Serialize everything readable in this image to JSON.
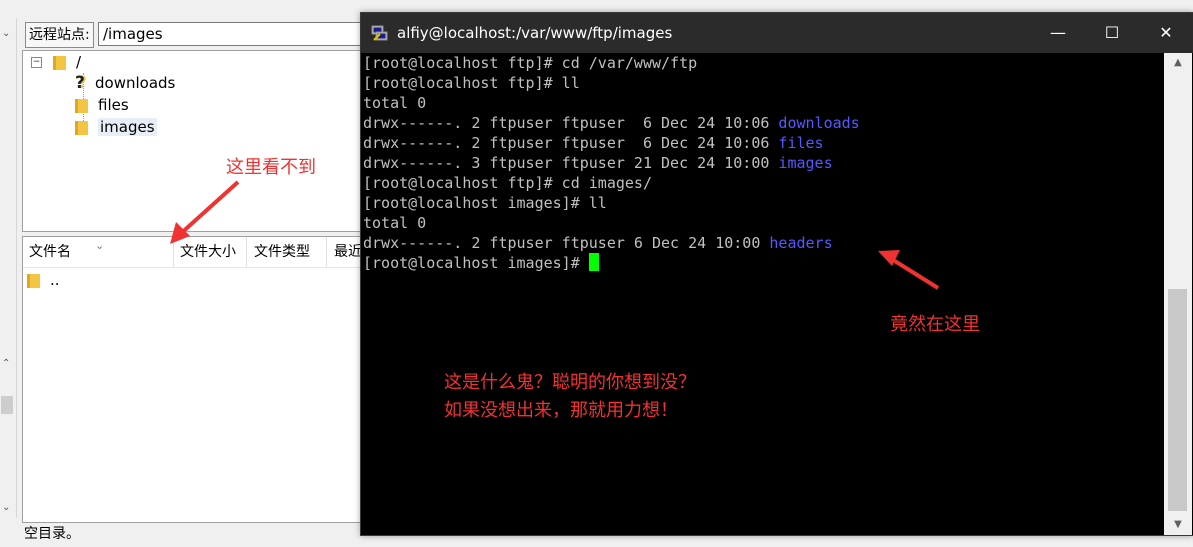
{
  "filezilla": {
    "remote_site_label": "远程站点:",
    "remote_site_path": "/images",
    "tree": {
      "root": "/",
      "children": [
        "downloads",
        "files",
        "images"
      ],
      "selected": "images"
    },
    "list_columns": [
      "文件名",
      "文件大小",
      "文件类型",
      "最近"
    ],
    "list_rows": [
      ".."
    ],
    "status": "空目录。"
  },
  "terminal": {
    "title": "alfiy@localhost:/var/www/ftp/images",
    "window_buttons": {
      "minimize": "—",
      "maximize": "☐",
      "close": "✕"
    },
    "lines": [
      {
        "text": "[root@localhost ftp]# cd /var/www/ftp"
      },
      {
        "text": "[root@localhost ftp]# ll"
      },
      {
        "text": "total 0"
      },
      {
        "text": "drwx------. 2 ftpuser ftpuser  6 Dec 24 10:06 ",
        "dir": "downloads"
      },
      {
        "text": "drwx------. 2 ftpuser ftpuser  6 Dec 24 10:06 ",
        "dir": "files"
      },
      {
        "text": "drwx------. 3 ftpuser ftpuser 21 Dec 24 10:00 ",
        "dir": "images"
      },
      {
        "text": "[root@localhost ftp]# cd images/"
      },
      {
        "text": "[root@localhost images]# ll"
      },
      {
        "text": "total 0"
      },
      {
        "text": "drwx------. 2 ftpuser ftpuser 6 Dec 24 10:00 ",
        "dir": "headers"
      },
      {
        "text": "[root@localhost images]# ",
        "cursor": true
      }
    ],
    "colors": {
      "background": "#000000",
      "text": "#c0c0c0",
      "directory": "#5757ff",
      "cursor": "#00ff00"
    }
  },
  "annotations": {
    "cant_see_here": "这里看不到",
    "actually_here": "竟然在这里",
    "question_line1": "这是什么鬼？聪明的你想到没？",
    "question_line2": "如果没想出来，那就用力想！",
    "color": "#f03232"
  }
}
